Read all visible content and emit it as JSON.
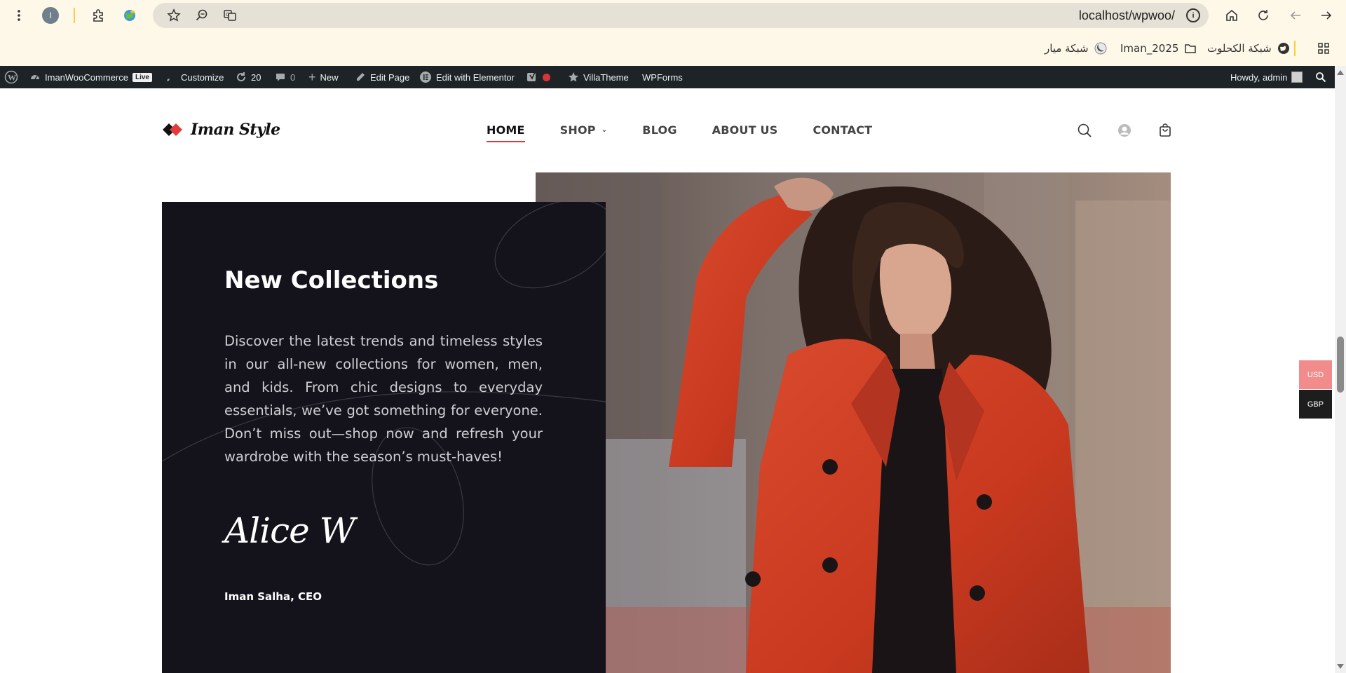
{
  "browser": {
    "url": "localhost/wpwoo/",
    "profile_initial": "I",
    "icons": [
      "menu-dots-icon",
      "extensions-icon",
      "globe-extension-icon",
      "star-icon",
      "zoom-icon",
      "translate-icon",
      "info-icon",
      "home-icon",
      "reload-icon",
      "back-icon",
      "forward-icon",
      "apps-grid-icon"
    ],
    "bookmarks": [
      {
        "label": "شبكة الكحلوت",
        "icon": "globe-icon"
      },
      {
        "label": "Iman_2025",
        "icon": "folder-icon"
      },
      {
        "label": "شبكة ميار",
        "icon": "moon-icon"
      }
    ]
  },
  "admin_bar": {
    "site_name": "ImanWooCommerce",
    "live_badge": "Live",
    "customize": "Customize",
    "updates_count": "20",
    "comments_count": "0",
    "new_label": "New",
    "edit_page": "Edit Page",
    "edit_elementor": "Edit with Elementor",
    "villatheme": "VillaTheme",
    "wpforms": "WPForms",
    "howdy": "Howdy, admin"
  },
  "header": {
    "logo_text": "Iman Style",
    "nav": [
      "HOME",
      "SHOP",
      "BLOG",
      "ABOUT US",
      "CONTACT"
    ],
    "active_nav": "HOME"
  },
  "hero": {
    "title": "New Collections",
    "body": "Discover the latest trends and timeless styles in our all-new collections for women, men, and kids. From chic designs to everyday essentials, we’ve got something for everyone. Don’t miss out—shop now and refresh your wardrobe with the season’s must-haves!",
    "signature": "Alice W",
    "author_role": "Iman Salha, CEO"
  },
  "currency": {
    "options": [
      "USD",
      "GBP"
    ],
    "selected": "USD"
  },
  "colors": {
    "accent": "#d93a3a",
    "panel_bg": "#14121a",
    "usd_bg": "#f28b8b",
    "gbp_bg": "#1d1d1d",
    "admin_bar_bg": "#1d2327",
    "chrome_bg": "#fdf8e8"
  }
}
